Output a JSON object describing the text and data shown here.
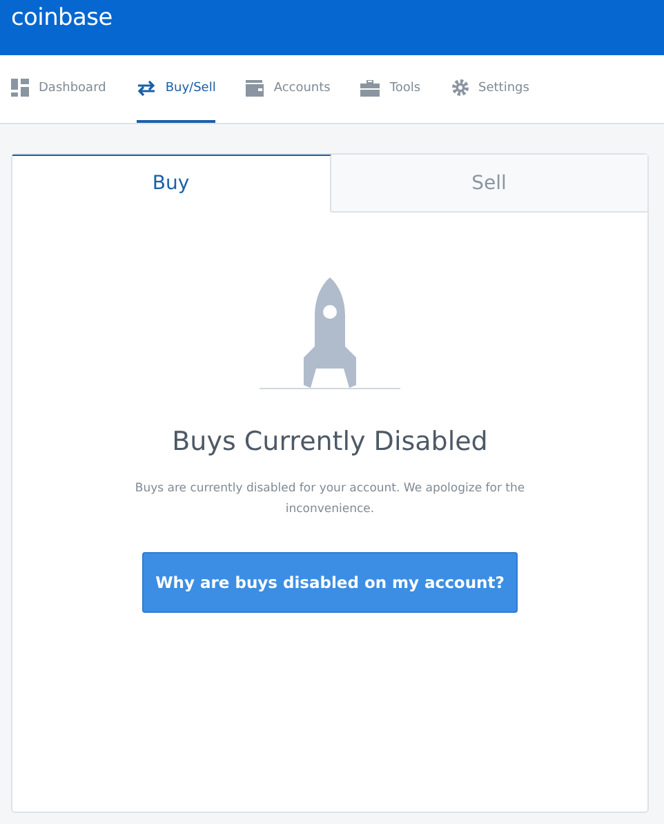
{
  "header": {
    "logo": "coinbase"
  },
  "nav": [
    {
      "label": "Dashboard",
      "selected": false
    },
    {
      "label": "Buy/Sell",
      "selected": true
    },
    {
      "label": "Accounts",
      "selected": false
    },
    {
      "label": "Tools",
      "selected": false
    },
    {
      "label": "Settings",
      "selected": false
    }
  ],
  "tabs": [
    {
      "label": "Buy",
      "selected": true
    },
    {
      "label": "Sell",
      "selected": false
    }
  ],
  "notice": {
    "title": "Buys Currently Disabled",
    "message": "Buys are currently disabled for your account. We apologize for the inconvenience.",
    "button": "Why are buys disabled on my account?"
  }
}
